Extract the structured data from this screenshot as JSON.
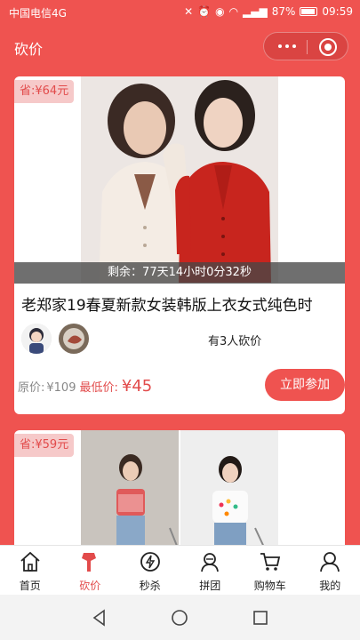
{
  "status": {
    "carrier": "中国电信4G",
    "battery": "87%",
    "time": "09:59",
    "network": "4G"
  },
  "header": {
    "title": "砍价"
  },
  "products": [
    {
      "save": "省:¥64元",
      "countdown": "剩余：77天14小时0分32秒",
      "title": "老郑家19春夏新款女装韩版上衣女式纯色时",
      "bargain_count": "有3人砍价",
      "orig_label": "原价:",
      "orig_price": "¥109",
      "min_label": "最低价:",
      "min_price": "¥45",
      "button": "立即参加"
    },
    {
      "save": "省:¥59元"
    }
  ],
  "tabbar": {
    "items": [
      {
        "label": "首页",
        "icon": "home-icon"
      },
      {
        "label": "砍价",
        "icon": "axe-icon"
      },
      {
        "label": "秒杀",
        "icon": "flash-sale-icon"
      },
      {
        "label": "拼团",
        "icon": "group-buy-icon"
      },
      {
        "label": "购物车",
        "icon": "cart-icon"
      },
      {
        "label": "我的",
        "icon": "user-icon"
      }
    ],
    "active_index": 1
  },
  "colors": {
    "accent": "#ef5350",
    "price_red": "#e24b4b"
  }
}
